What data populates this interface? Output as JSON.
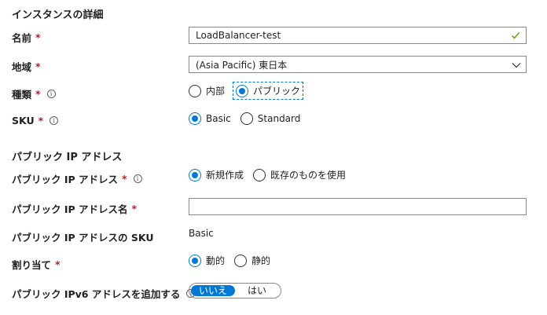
{
  "section_instance": {
    "title": "インスタンスの詳細",
    "name": {
      "label": "名前",
      "required": "*",
      "value": "LoadBalancer-test"
    },
    "region": {
      "label": "地域",
      "required": "*",
      "value": "(Asia Pacific) 東日本"
    },
    "type": {
      "label": "種類",
      "required": "*",
      "options": [
        "内部",
        "パブリック"
      ],
      "selected": "パブリック"
    },
    "sku": {
      "label": "SKU",
      "required": "*",
      "options": [
        "Basic",
        "Standard"
      ],
      "selected": "Basic"
    }
  },
  "section_public_ip": {
    "title": "パブリック IP アドレス",
    "public_ip": {
      "label": "パブリック IP アドレス",
      "required": "*",
      "options": [
        "新規作成",
        "既存のものを使用"
      ],
      "selected": "新規作成"
    },
    "public_ip_name": {
      "label": "パブリック IP アドレス名",
      "required": "*",
      "value": ""
    },
    "public_ip_sku": {
      "label": "パブリック IP アドレスの SKU",
      "value": "Basic"
    },
    "assignment": {
      "label": "割り当て",
      "required": "*",
      "options": [
        "動的",
        "静的"
      ],
      "selected": "動的"
    },
    "ipv6": {
      "label": "パブリック IPv6 アドレスを追加する",
      "options": [
        "いいえ",
        "はい"
      ],
      "selected": "いいえ"
    }
  },
  "icons": {
    "info": "info-icon",
    "valid": "checkmark-icon",
    "dropdown": "chevron-down-icon"
  },
  "colors": {
    "accent": "#0078d4",
    "required": "#a4262c",
    "valid": "#57a300"
  }
}
